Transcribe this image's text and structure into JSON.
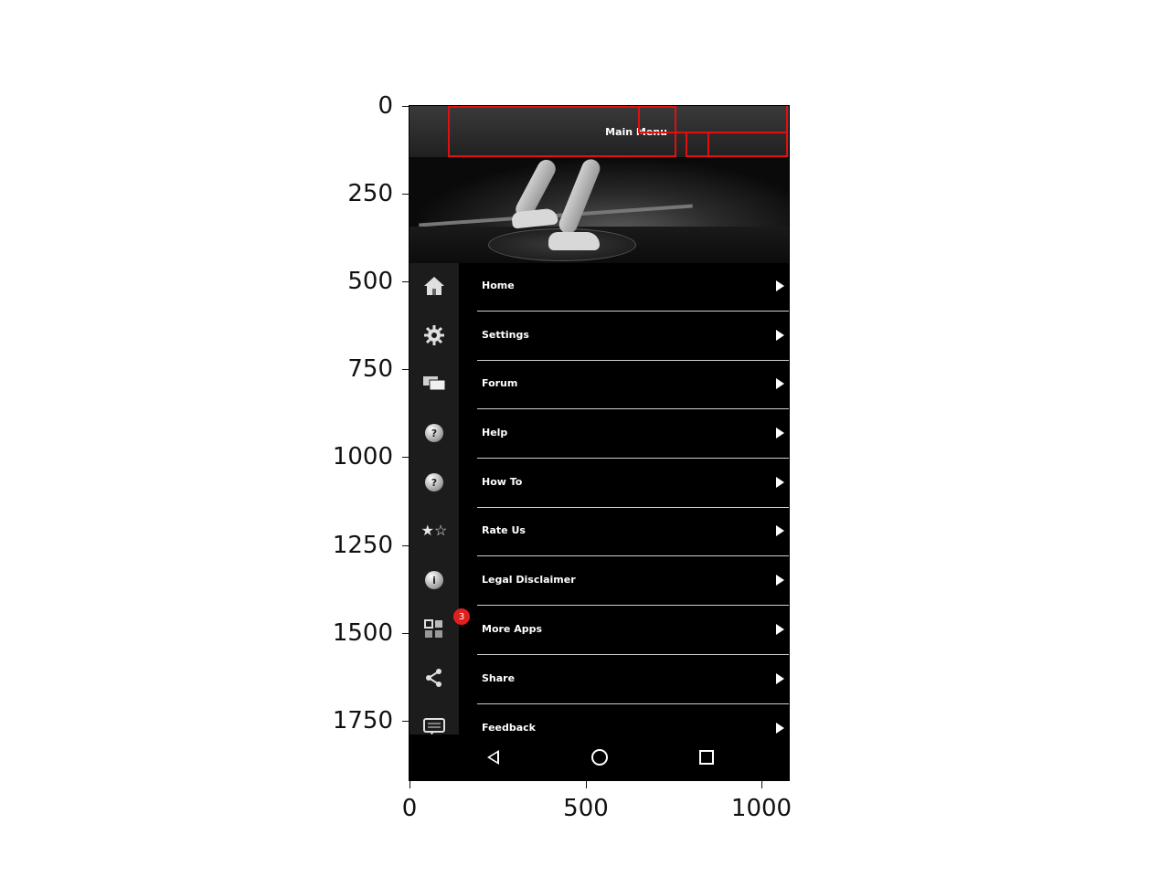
{
  "axes": {
    "y_ticks": [
      "0",
      "250",
      "500",
      "750",
      "1000",
      "1250",
      "1500",
      "1750"
    ],
    "x_ticks": [
      "0",
      "500",
      "1000"
    ]
  },
  "app": {
    "header": {
      "title": "Main Menu"
    },
    "hero": {
      "image": "fitness-workout-banner"
    },
    "sidebar_icons": [
      {
        "icon": "home-icon"
      },
      {
        "icon": "gear-icon"
      },
      {
        "icon": "chat-bubbles-icon"
      },
      {
        "icon": "help-icon",
        "glyph": "?"
      },
      {
        "icon": "help-icon",
        "glyph": "?"
      },
      {
        "icon": "stars-icon",
        "glyph": "★☆"
      },
      {
        "icon": "info-icon",
        "glyph": "i"
      },
      {
        "icon": "apps-icon",
        "badge": "3"
      },
      {
        "icon": "share-icon"
      },
      {
        "icon": "feedback-icon"
      }
    ],
    "menu": [
      {
        "label": "Home"
      },
      {
        "label": "Settings"
      },
      {
        "label": "Forum"
      },
      {
        "label": "Help"
      },
      {
        "label": "How To"
      },
      {
        "label": "Rate Us"
      },
      {
        "label": "Legal Disclaimer"
      },
      {
        "label": "More Apps"
      },
      {
        "label": "Share"
      },
      {
        "label": "Feedback"
      }
    ],
    "navbar": [
      "back-icon",
      "home-circle-icon",
      "recents-icon"
    ]
  },
  "colors": {
    "highlight_box": "#e01010",
    "background": "#000000",
    "sidebar": "#1c1c1c",
    "badge": "#e02020"
  }
}
